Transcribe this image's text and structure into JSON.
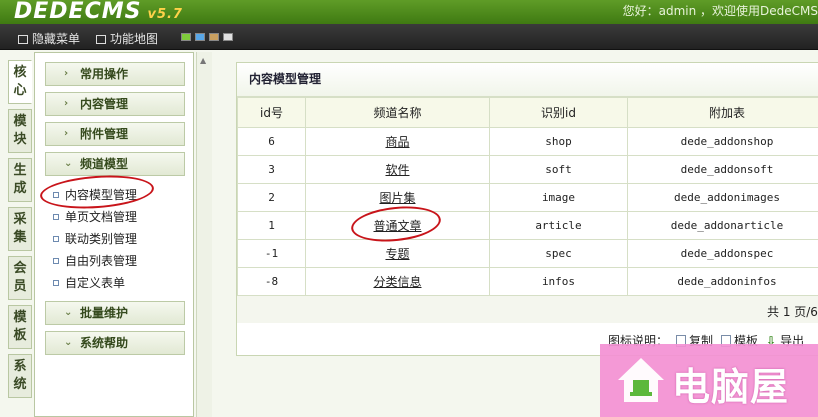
{
  "app": {
    "logo": "DEDECMS",
    "version": "v5.7",
    "welcome": "您好：admin ，欢迎使用DedeCMS"
  },
  "toolbar": {
    "hide_menu": "隐藏菜单",
    "site_map": "功能地图",
    "swatches": [
      "#7ecb3b",
      "#58a7e8",
      "#c9a060",
      "#e0e0e0"
    ]
  },
  "vtabs": [
    {
      "label": "核心",
      "active": true
    },
    {
      "label": "模块"
    },
    {
      "label": "生成"
    },
    {
      "label": "采集"
    },
    {
      "label": "会员"
    },
    {
      "label": "模板"
    },
    {
      "label": "系统"
    }
  ],
  "menu": {
    "groups": [
      "常用操作",
      "内容管理",
      "附件管理",
      "频道模型"
    ],
    "channel_items": [
      "内容模型管理",
      "单页文档管理",
      "联动类别管理",
      "自由列表管理",
      "自定义表单"
    ],
    "bottom_groups": [
      "批量维护",
      "系统帮助"
    ]
  },
  "main": {
    "title": "内容模型管理",
    "columns": [
      "id号",
      "频道名称",
      "识别id",
      "附加表"
    ],
    "rows": [
      {
        "id": "6",
        "name": "商品",
        "nid": "shop",
        "table": "dede_addonshop"
      },
      {
        "id": "3",
        "name": "软件",
        "nid": "soft",
        "table": "dede_addonsoft"
      },
      {
        "id": "2",
        "name": "图片集",
        "nid": "image",
        "table": "dede_addonimages"
      },
      {
        "id": "1",
        "name": "普通文章",
        "nid": "article",
        "table": "dede_addonarticle"
      },
      {
        "id": "-1",
        "name": "专题",
        "nid": "spec",
        "table": "dede_addonspec"
      },
      {
        "id": "-8",
        "name": "分类信息",
        "nid": "infos",
        "table": "dede_addoninfos"
      }
    ],
    "pager": "共 1 页/6"
  },
  "legend": {
    "label": "图标说明：",
    "copy": "复制",
    "template": "模板",
    "export": "导出"
  },
  "watermark": {
    "text": "电脑屋"
  },
  "colors": {
    "header_green": "#4a8a1c",
    "annotation_red": "#c8141a",
    "watermark_pink": "#f390d4"
  }
}
